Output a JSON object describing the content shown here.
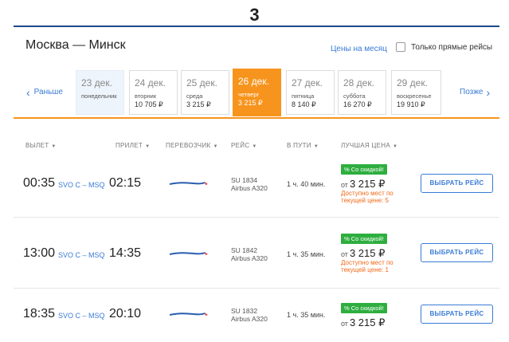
{
  "step_number": "3",
  "header": {
    "route": "Москва — Минск",
    "month_prices_link": "Цены на месяц",
    "direct_only_label": "Только прямые рейсы"
  },
  "nav": {
    "prev": "Раньше",
    "next": "Позже"
  },
  "dates": [
    {
      "day": "23 дек.",
      "weekday": "понедельник",
      "price": "",
      "state": "muted"
    },
    {
      "day": "24 дек.",
      "weekday": "вторник",
      "price": "10 705 ₽",
      "state": "normal"
    },
    {
      "day": "25 дек.",
      "weekday": "среда",
      "price": "3 215 ₽",
      "state": "normal"
    },
    {
      "day": "26 дек.",
      "weekday": "четверг",
      "price": "3 215 ₽",
      "state": "active"
    },
    {
      "day": "27 дек.",
      "weekday": "пятница",
      "price": "8 140 ₽",
      "state": "normal"
    },
    {
      "day": "28 дек.",
      "weekday": "суббота",
      "price": "16 270 ₽",
      "state": "normal"
    },
    {
      "day": "29 дек.",
      "weekday": "воскресенье",
      "price": "19 910 ₽",
      "state": "normal"
    }
  ],
  "columns": {
    "departure": "ВЫЛЕТ",
    "arrival": "ПРИЛЕТ",
    "carrier": "ПЕРЕВОЗЧИК",
    "flight": "РЕЙС",
    "duration": "В ПУТИ",
    "best_price": "ЛУЧШАЯ ЦЕНА"
  },
  "flights": [
    {
      "dep": "00:35",
      "airports": "SVO C – MSQ",
      "arr": "02:15",
      "flight_no": "SU 1834",
      "aircraft": "Airbus A320",
      "duration": "1 ч. 40 мин.",
      "promo": "% Со скидкой!",
      "price_prefix": "от",
      "price": "3 215 ₽",
      "seats_line1": "Доступно мест по",
      "seats_line2": "текущей цене: 5",
      "button": "ВЫБРАТЬ РЕЙС"
    },
    {
      "dep": "13:00",
      "airports": "SVO C – MSQ",
      "arr": "14:35",
      "flight_no": "SU 1842",
      "aircraft": "Airbus A320",
      "duration": "1 ч. 35 мин.",
      "promo": "% Со скидкой!",
      "price_prefix": "от",
      "price": "3 215 ₽",
      "seats_line1": "Доступно мест по",
      "seats_line2": "текущей цене: 1",
      "button": "ВЫБРАТЬ РЕЙС"
    },
    {
      "dep": "18:35",
      "airports": "SVO C – MSQ",
      "arr": "20:10",
      "flight_no": "SU 1832",
      "aircraft": "Airbus A320",
      "duration": "1 ч. 35 мин.",
      "promo": "% Со скидкой!",
      "price_prefix": "от",
      "price": "3 215 ₽",
      "seats_line1": "",
      "seats_line2": "",
      "button": "ВЫБРАТЬ РЕЙС"
    }
  ],
  "colors": {
    "accent": "#f7941d",
    "link": "#3a7bd5",
    "promo": "#2eae3f",
    "warning": "#f06a1a",
    "rule": "#1a4a8a"
  }
}
